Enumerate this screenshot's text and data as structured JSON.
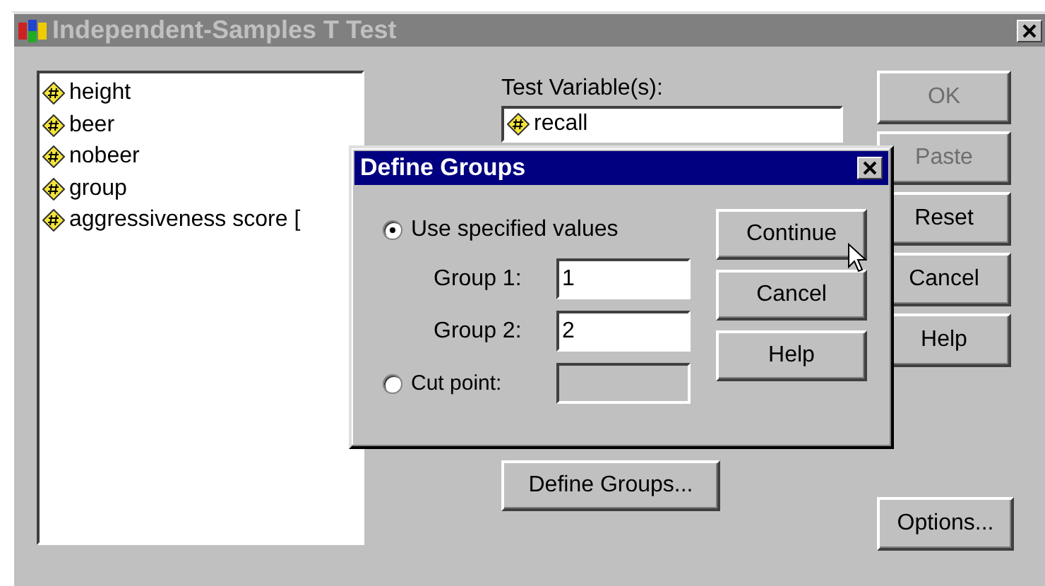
{
  "window": {
    "title": "Independent-Samples T Test",
    "active": false
  },
  "variables": [
    {
      "name": "height"
    },
    {
      "name": "beer"
    },
    {
      "name": "nobeer"
    },
    {
      "name": "group"
    },
    {
      "name": "aggressiveness score ["
    }
  ],
  "test_variables": {
    "label": "Test Variable(s):",
    "items": [
      "recall"
    ]
  },
  "buttons": [
    {
      "label": "OK",
      "disabled": true
    },
    {
      "label": "Paste",
      "disabled": true
    },
    {
      "label": "Reset",
      "disabled": false
    },
    {
      "label": "Cancel",
      "disabled": false
    },
    {
      "label": "Help",
      "disabled": false
    }
  ],
  "define_groups_button": "Define Groups...",
  "options_button": "Options...",
  "dialog": {
    "title": "Define Groups",
    "active": true,
    "options": [
      {
        "label": "Use specified values",
        "selected": true
      },
      {
        "label": "Cut point:",
        "selected": false
      }
    ],
    "group_fields": [
      {
        "label": "Group 1:",
        "value": "1"
      },
      {
        "label": "Group 2:",
        "value": "2"
      }
    ],
    "cut_point_field": {
      "disabled": true
    },
    "buttons": [
      {
        "label": "Continue"
      },
      {
        "label": "Cancel"
      },
      {
        "label": "Help"
      }
    ]
  }
}
